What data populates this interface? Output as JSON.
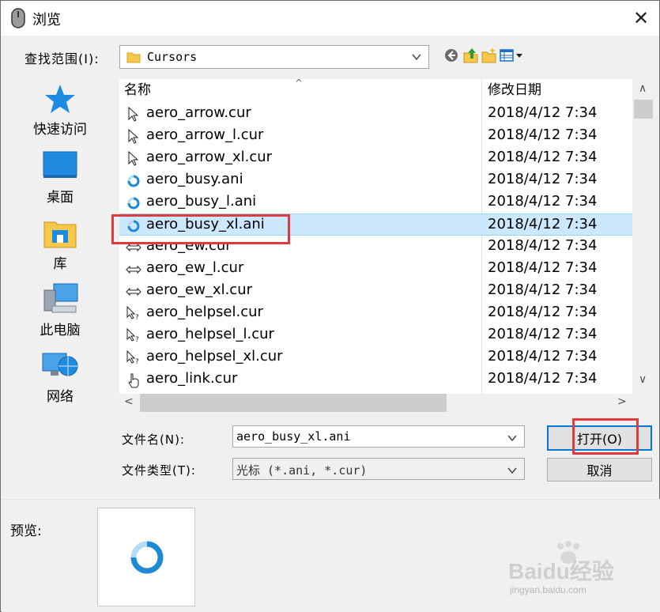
{
  "window": {
    "title": "浏览",
    "close_glyph": "✕"
  },
  "lookin": {
    "label": "查找范围(I):",
    "value": "Cursors"
  },
  "toolbar": {
    "icons": [
      "back-icon",
      "up-folder-icon",
      "new-folder-icon",
      "view-menu-icon"
    ]
  },
  "places": [
    {
      "label": "快速访问",
      "icon": "star-icon"
    },
    {
      "label": "桌面",
      "icon": "desktop-icon"
    },
    {
      "label": "库",
      "icon": "library-icon"
    },
    {
      "label": "此电脑",
      "icon": "computer-icon"
    },
    {
      "label": "网络",
      "icon": "network-icon"
    }
  ],
  "columns": {
    "name": "名称",
    "date": "修改日期",
    "sort_glyph": "^"
  },
  "files": [
    {
      "name": "aero_arrow.cur",
      "date": "2018/4/12 7:34",
      "icon": "arrow-cursor-icon"
    },
    {
      "name": "aero_arrow_l.cur",
      "date": "2018/4/12 7:34",
      "icon": "arrow-cursor-icon"
    },
    {
      "name": "aero_arrow_xl.cur",
      "date": "2018/4/12 7:34",
      "icon": "arrow-cursor-icon"
    },
    {
      "name": "aero_busy.ani",
      "date": "2018/4/12 7:34",
      "icon": "busy-cursor-icon"
    },
    {
      "name": "aero_busy_l.ani",
      "date": "2018/4/12 7:34",
      "icon": "busy-cursor-icon"
    },
    {
      "name": "aero_busy_xl.ani",
      "date": "2018/4/12 7:34",
      "icon": "busy-cursor-icon",
      "selected": true
    },
    {
      "name": "aero_ew.cur",
      "date": "2018/4/12 7:34",
      "icon": "resize-ew-icon"
    },
    {
      "name": "aero_ew_l.cur",
      "date": "2018/4/12 7:34",
      "icon": "resize-ew-icon"
    },
    {
      "name": "aero_ew_xl.cur",
      "date": "2018/4/12 7:34",
      "icon": "resize-ew-icon"
    },
    {
      "name": "aero_helpsel.cur",
      "date": "2018/4/12 7:34",
      "icon": "help-cursor-icon"
    },
    {
      "name": "aero_helpsel_l.cur",
      "date": "2018/4/12 7:34",
      "icon": "help-cursor-icon"
    },
    {
      "name": "aero_helpsel_xl.cur",
      "date": "2018/4/12 7:34",
      "icon": "help-cursor-icon"
    },
    {
      "name": "aero_link.cur",
      "date": "2018/4/12 7:34",
      "icon": "hand-cursor-icon"
    }
  ],
  "filename": {
    "label": "文件名(N):",
    "value": "aero_busy_xl.ani"
  },
  "filetype": {
    "label": "文件类型(T):",
    "value": "光标 (*.ani, *.cur)"
  },
  "buttons": {
    "open": "打开(O)",
    "cancel": "取消"
  },
  "preview": {
    "label": "预览:"
  },
  "watermark": {
    "text": "Baidu经验",
    "sub": "jingyan.baidu.com"
  },
  "colors": {
    "selection": "#cce8ff",
    "highlight_box": "#e0393e",
    "accent": "#0078d7",
    "busy_ring": "#1e8ad6"
  }
}
